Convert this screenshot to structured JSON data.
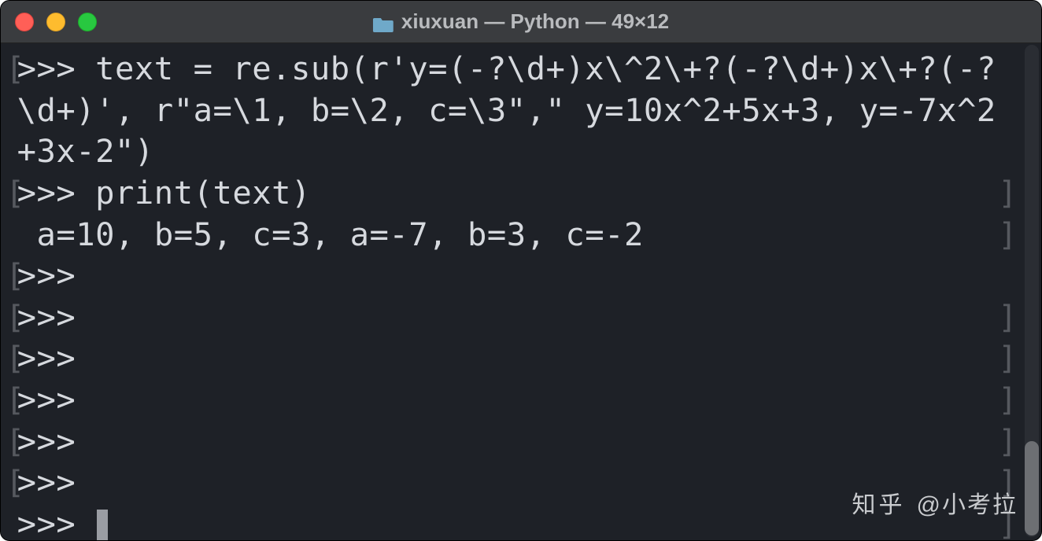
{
  "titlebar": {
    "title": "xiuxuan — Python — 49×12",
    "folder_icon": "folder-icon"
  },
  "terminal": {
    "prompt": ">>> ",
    "lines": {
      "l1": ">>> text = re.sub(r'y=(-?\\d+)x\\^2\\+?(-?\\d+)x\\+?(-?\\d+)', r\"a=\\1, b=\\2, c=\\3\",\" y=10x^2+5x+3, y=-7x^2+3x-2\")",
      "l2": ">>> print(text)",
      "l3": " a=10, b=5, c=3, a=-7, b=3, c=-2",
      "l4": ">>> ",
      "l5": ">>> ",
      "l6": ">>> ",
      "l7": ">>> ",
      "l8": ">>> ",
      "l9": ">>> ",
      "l10": ">>> "
    }
  },
  "watermark": {
    "brand": "知乎",
    "handle": "@小考拉"
  }
}
